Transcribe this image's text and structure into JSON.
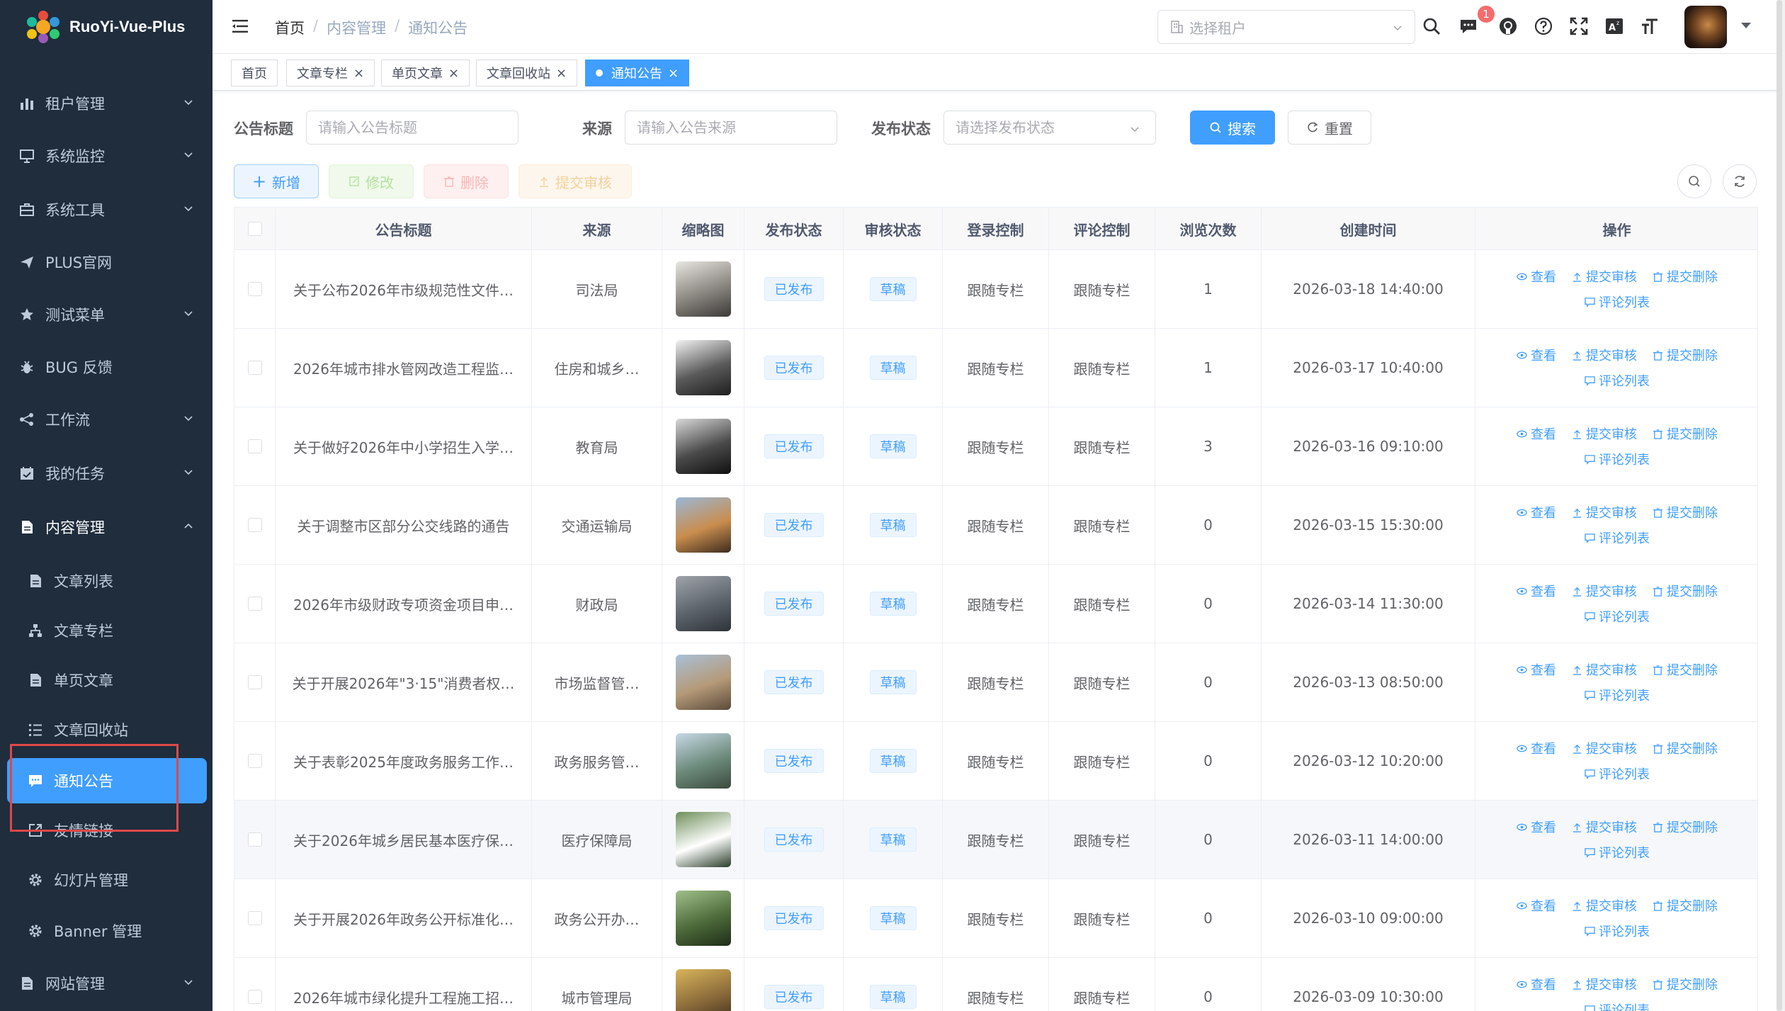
{
  "app": {
    "title": "RuoYi-Vue-Plus"
  },
  "sidebar": {
    "items": [
      {
        "label": "租户管理",
        "icon": "chart-bar-icon",
        "arrow": "down"
      },
      {
        "label": "系统监控",
        "icon": "monitor-icon",
        "arrow": "down"
      },
      {
        "label": "系统工具",
        "icon": "toolbox-icon",
        "arrow": "down"
      },
      {
        "label": "PLUS官网",
        "icon": "paper-plane-icon",
        "arrow": ""
      },
      {
        "label": "测试菜单",
        "icon": "star-icon",
        "arrow": "down"
      },
      {
        "label": "BUG 反馈",
        "icon": "bug-icon",
        "arrow": ""
      },
      {
        "label": "工作流",
        "icon": "flow-icon",
        "arrow": "down"
      },
      {
        "label": "我的任务",
        "icon": "calendar-check-icon",
        "arrow": "down"
      },
      {
        "label": "内容管理",
        "icon": "document-icon",
        "arrow": "up"
      }
    ],
    "sub_items": [
      {
        "label": "文章列表",
        "icon": "document-icon"
      },
      {
        "label": "文章专栏",
        "icon": "tree-icon"
      },
      {
        "label": "单页文章",
        "icon": "document-icon"
      },
      {
        "label": "文章回收站",
        "icon": "list-icon"
      },
      {
        "label": "通知公告",
        "icon": "message-icon"
      },
      {
        "label": "友情链接",
        "icon": "external-link-icon"
      },
      {
        "label": "幻灯片管理",
        "icon": "gear-icon"
      },
      {
        "label": "Banner 管理",
        "icon": "gear-icon"
      }
    ],
    "last_item": {
      "label": "网站管理",
      "icon": "document-icon",
      "arrow": "down"
    }
  },
  "header": {
    "breadcrumb": [
      "首页",
      "内容管理",
      "通知公告"
    ],
    "tenant_placeholder": "选择租户",
    "notification_count": "1"
  },
  "tags": [
    {
      "label": "首页",
      "closable": false
    },
    {
      "label": "文章专栏",
      "closable": true
    },
    {
      "label": "单页文章",
      "closable": true
    },
    {
      "label": "文章回收站",
      "closable": true
    },
    {
      "label": "通知公告",
      "closable": true,
      "active": true
    }
  ],
  "search": {
    "title_label": "公告标题",
    "title_placeholder": "请输入公告标题",
    "source_label": "来源",
    "source_placeholder": "请输入公告来源",
    "status_label": "发布状态",
    "status_placeholder": "请选择发布状态",
    "search_btn": "搜索",
    "reset_btn": "重置"
  },
  "toolbar": {
    "add": "新增",
    "edit": "修改",
    "delete": "删除",
    "submit_review": "提交审核"
  },
  "table": {
    "columns": [
      "公告标题",
      "来源",
      "缩略图",
      "发布状态",
      "审核状态",
      "登录控制",
      "评论控制",
      "浏览次数",
      "创建时间",
      "操作"
    ],
    "actions": {
      "view": "查看",
      "submit_review": "提交审核",
      "submit_delete": "提交删除",
      "comments": "评论列表"
    },
    "rows": [
      {
        "title": "关于公布2026年市级规范性文件…",
        "source": "司法局",
        "publish": "已发布",
        "review": "草稿",
        "login": "跟随专栏",
        "comment": "跟随专栏",
        "views": "1",
        "created": "2026-03-18 14:40:00",
        "thumb_colors": [
          "#e8e6e2",
          "#8a8680",
          "#3b3a38"
        ]
      },
      {
        "title": "2026年城市排水管网改造工程监…",
        "source": "住房和城乡…",
        "publish": "已发布",
        "review": "草稿",
        "login": "跟随专栏",
        "comment": "跟随专栏",
        "views": "1",
        "created": "2026-03-17 10:40:00",
        "thumb_colors": [
          "#f2f2f2",
          "#5a5a5a",
          "#1e1e1e"
        ]
      },
      {
        "title": "关于做好2026年中小学招生入学…",
        "source": "教育局",
        "publish": "已发布",
        "review": "草稿",
        "login": "跟随专栏",
        "comment": "跟随专栏",
        "views": "3",
        "created": "2026-03-16 09:10:00",
        "thumb_colors": [
          "#d8d8d8",
          "#4a4a4a",
          "#101010"
        ]
      },
      {
        "title": "关于调整市区部分公交线路的通告",
        "source": "交通运输局",
        "publish": "已发布",
        "review": "草稿",
        "login": "跟随专栏",
        "comment": "跟随专栏",
        "views": "0",
        "created": "2026-03-15 15:30:00",
        "thumb_colors": [
          "#9ab7d6",
          "#c98d4e",
          "#3d2c1e"
        ]
      },
      {
        "title": "2026年市级财政专项资金项目申…",
        "source": "财政局",
        "publish": "已发布",
        "review": "草稿",
        "login": "跟随专栏",
        "comment": "跟随专栏",
        "views": "0",
        "created": "2026-03-14 11:30:00",
        "thumb_colors": [
          "#9fa4aa",
          "#5c636b",
          "#2e3338"
        ]
      },
      {
        "title": "关于开展2026年\"3·15\"消费者权…",
        "source": "市场监督管…",
        "publish": "已发布",
        "review": "草稿",
        "login": "跟随专栏",
        "comment": "跟随专栏",
        "views": "0",
        "created": "2026-03-13 08:50:00",
        "thumb_colors": [
          "#a9c0d8",
          "#b59a78",
          "#5b4a3a"
        ]
      },
      {
        "title": "关于表彰2025年度政务服务工作…",
        "source": "政务服务管…",
        "publish": "已发布",
        "review": "草稿",
        "login": "跟随专栏",
        "comment": "跟随专栏",
        "views": "0",
        "created": "2026-03-12 10:20:00",
        "thumb_colors": [
          "#c8d8e6",
          "#6b8a7a",
          "#3c4a3e"
        ]
      },
      {
        "title": "关于2026年城乡居民基本医疗保…",
        "source": "医疗保障局",
        "publish": "已发布",
        "review": "草稿",
        "login": "跟随专栏",
        "comment": "跟随专栏",
        "views": "0",
        "created": "2026-03-11 14:00:00",
        "thumb_colors": [
          "#6f8f5a",
          "#ffffff",
          "#2a3d2a"
        ]
      },
      {
        "title": "关于开展2026年政务公开标准化…",
        "source": "政务公开办…",
        "publish": "已发布",
        "review": "草稿",
        "login": "跟随专栏",
        "comment": "跟随专栏",
        "views": "0",
        "created": "2026-03-10 09:00:00",
        "thumb_colors": [
          "#9fbf8a",
          "#4d6b3a",
          "#1f2d18"
        ]
      },
      {
        "title": "2026年城市绿化提升工程施工招…",
        "source": "城市管理局",
        "publish": "已发布",
        "review": "草稿",
        "login": "跟随专栏",
        "comment": "跟随专栏",
        "views": "0",
        "created": "2026-03-09 10:30:00",
        "thumb_colors": [
          "#d8b45a",
          "#8a6a3a",
          "#3a2a1a"
        ]
      }
    ]
  }
}
